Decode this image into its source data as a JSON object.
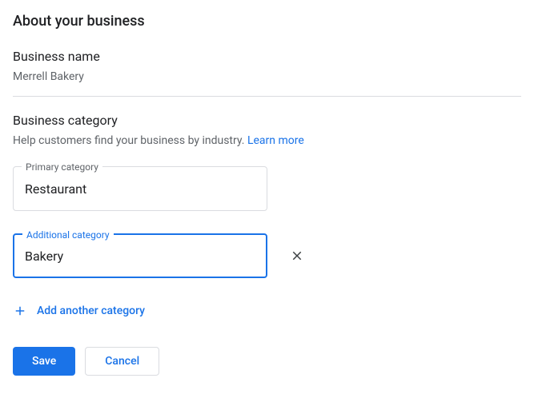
{
  "title": "About your business",
  "business_name": {
    "label": "Business name",
    "value": "Merrell Bakery"
  },
  "business_category": {
    "heading": "Business category",
    "help_text": "Help customers find your business by industry. ",
    "learn_more": "Learn more"
  },
  "primary_category": {
    "label": "Primary category",
    "value": "Restaurant"
  },
  "additional_category": {
    "label": "Additional category",
    "value": "Bakery"
  },
  "add_another_label": "Add another category",
  "buttons": {
    "save": "Save",
    "cancel": "Cancel"
  }
}
